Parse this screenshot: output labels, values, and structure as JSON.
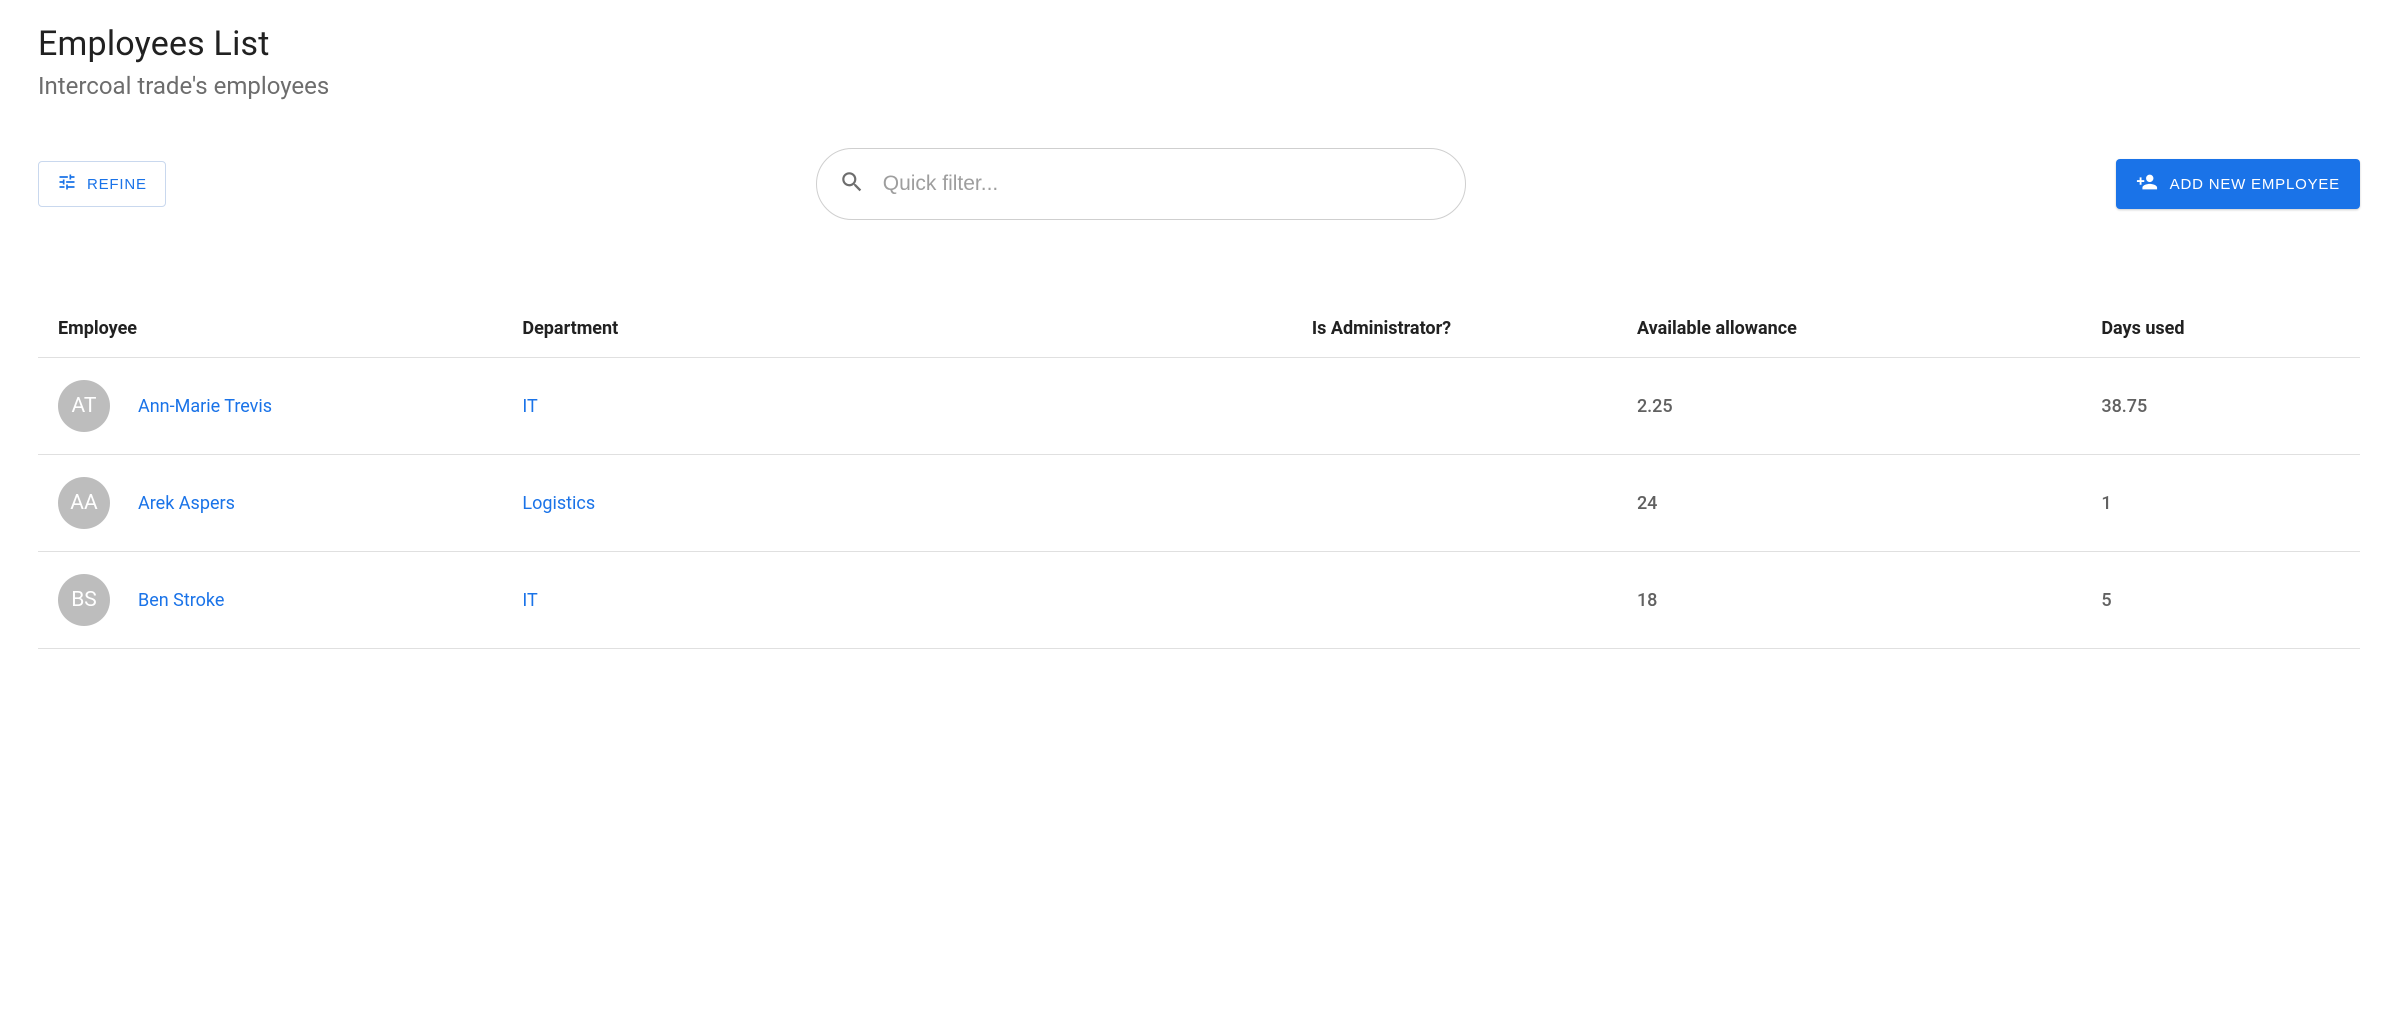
{
  "header": {
    "title": "Employees List",
    "subtitle": "Intercoal trade's employees"
  },
  "toolbar": {
    "refine_label": "REFINE",
    "search_placeholder": "Quick filter...",
    "add_label": "ADD NEW EMPLOYEE"
  },
  "table": {
    "columns": {
      "employee": "Employee",
      "department": "Department",
      "is_admin": "Is Administrator?",
      "allowance": "Available allowance",
      "days_used": "Days used"
    },
    "rows": [
      {
        "initials": "AT",
        "name": "Ann-Marie Trevis",
        "department": "IT",
        "is_admin": "",
        "allowance": "2.25",
        "days_used": "38.75"
      },
      {
        "initials": "AA",
        "name": "Arek Aspers",
        "department": "Logistics",
        "is_admin": "",
        "allowance": "24",
        "days_used": "1"
      },
      {
        "initials": "BS",
        "name": "Ben Stroke",
        "department": "IT",
        "is_admin": "",
        "allowance": "18",
        "days_used": "5"
      }
    ]
  }
}
